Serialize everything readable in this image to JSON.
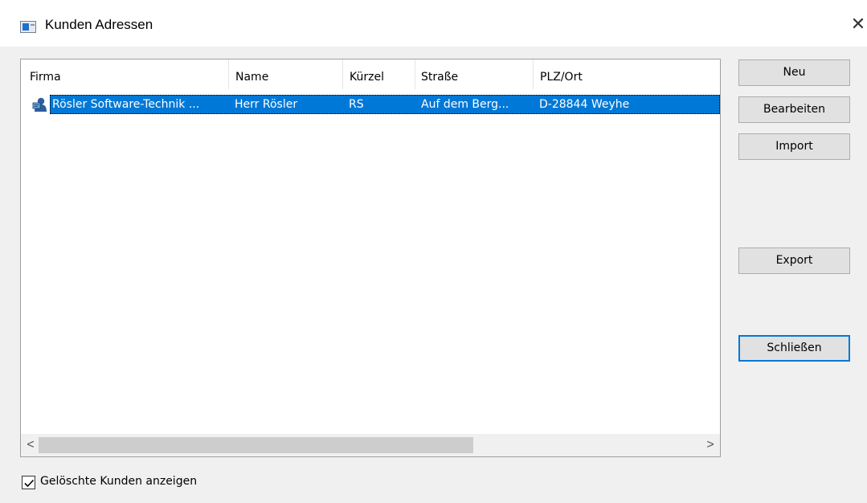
{
  "window": {
    "title": "Kunden Adressen",
    "close_glyph": "✕",
    "icon": "app-window-icon"
  },
  "list": {
    "columns": [
      "Firma",
      "Name",
      "Kürzel",
      "Straße",
      "PLZ/Ort"
    ],
    "rows": [
      {
        "icon": "customer-icon",
        "firma": "Rösler Software-Technik ...",
        "name": "Herr Rösler",
        "kuerzel": "RS",
        "strasse": "Auf dem Berg...",
        "plz_ort": "D-28844  Weyhe",
        "selected": true
      }
    ],
    "scroll": {
      "left_arrow": "<",
      "right_arrow": ">"
    }
  },
  "buttons": {
    "neu": "Neu",
    "bearbeiten": "Bearbeiten",
    "import": "Import",
    "export": "Export",
    "schliessen": "Schließen"
  },
  "options": {
    "show_deleted_label": "Gelöschte Kunden anzeigen",
    "show_deleted_checked": true
  },
  "colors": {
    "selection": "#0078d7",
    "window_bg": "#f0f0f0",
    "default_button_border": "#0078d7"
  }
}
